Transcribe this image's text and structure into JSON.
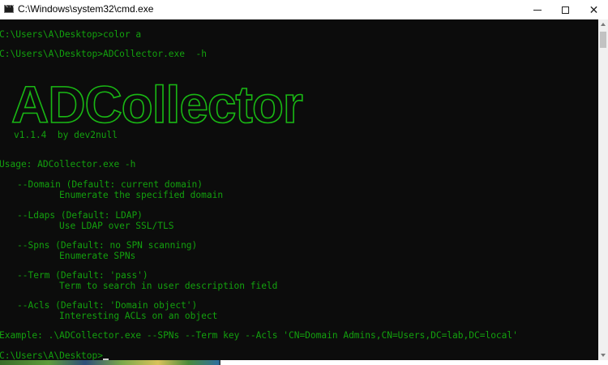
{
  "window": {
    "title": "C:\\Windows\\system32\\cmd.exe",
    "icon": "cmd-icon",
    "controls": {
      "minimize": "minimize-icon",
      "maximize": "maximize-icon",
      "close": "✕"
    }
  },
  "console": {
    "colors": {
      "background": "#0c0c0c",
      "text": "#13a10e"
    },
    "lines": {
      "cmd1": "C:\\Users\\A\\Desktop>color a",
      "cmd2": "C:\\Users\\A\\Desktop>ADCollector.exe  -h",
      "banner": "ADCollector",
      "version": "v1.1.4  by dev2null",
      "usage": "Usage: ADCollector.exe -h",
      "opt_domain": "--Domain (Default: current domain)",
      "opt_domain_desc": "Enumerate the specified domain",
      "opt_ldaps": "--Ldaps (Default: LDAP)",
      "opt_ldaps_desc": "Use LDAP over SSL/TLS",
      "opt_spns": "--Spns (Default: no SPN scanning)",
      "opt_spns_desc": "Enumerate SPNs",
      "opt_term": "--Term (Default: 'pass')",
      "opt_term_desc": "Term to search in user description field",
      "opt_acls": "--Acls (Default: 'Domain object')",
      "opt_acls_desc": "Interesting ACLs on an object",
      "example": "Example: .\\ADCollector.exe --SPNs --Term key --Acls 'CN=Domain Admins,CN=Users,DC=lab,DC=local'",
      "prompt": "C:\\Users\\A\\Desktop>"
    }
  }
}
